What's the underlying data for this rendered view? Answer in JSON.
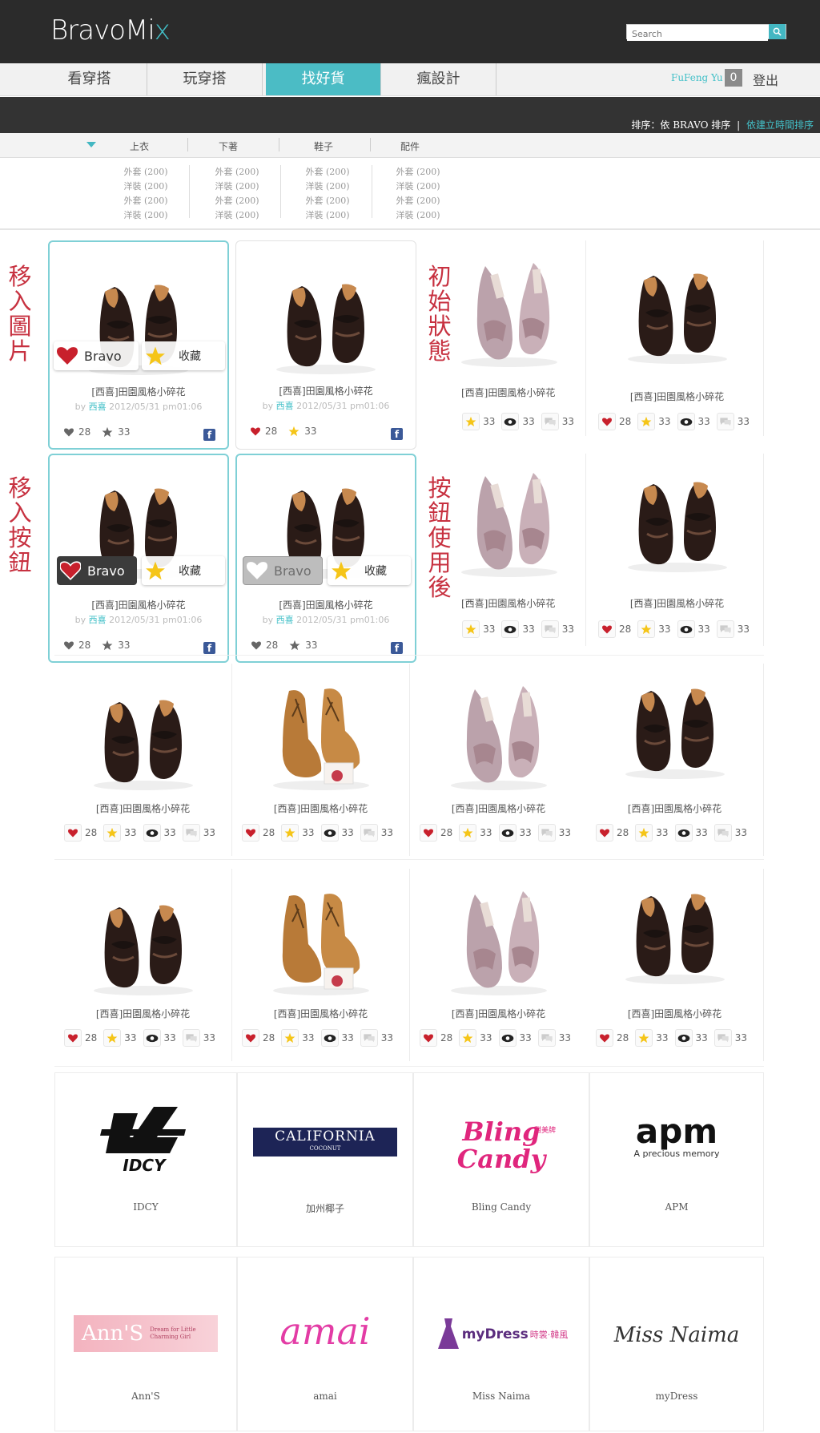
{
  "header": {
    "logo": "BravoMi",
    "logo_accent": "x",
    "search_placeholder": "Search",
    "user_name": "FuFeng Yu",
    "badge_count": "0",
    "logout": "登出"
  },
  "nav": {
    "tabs": [
      "看穿搭",
      "玩穿搭",
      "找好貨",
      "瘋設計"
    ],
    "active": "找好貨"
  },
  "sort": {
    "label": "排序：依 BRAVO 排序",
    "sep": "|",
    "link": "依建立時間排序"
  },
  "categories": {
    "heads": [
      "上衣",
      "下著",
      "鞋子",
      "配件"
    ],
    "sub": [
      "外套 (200)",
      "洋裝 (200)",
      "外套 (200)",
      "洋裝 (200)"
    ]
  },
  "annotations": {
    "a1": "移入圖片",
    "a2": "初始狀態",
    "a3": "移入按鈕",
    "a4": "按鈕使用後"
  },
  "product": {
    "title": "[西喜]田園風格小碎花",
    "by": "by",
    "user": "西喜",
    "date": "2012/05/31 pm01:06",
    "bravo_count": "28",
    "fav_count": "33",
    "view_count": "33",
    "comment_count": "33",
    "bravo_label": "Bravo",
    "fav_label": "收藏",
    "fb": "f"
  },
  "brands": [
    {
      "name": "IDCY",
      "logo": "IDCY"
    },
    {
      "name": "加州椰子",
      "logo": "CALIFORNIA"
    },
    {
      "name": "Bling Candy",
      "logo": "Bling Candy"
    },
    {
      "name": "APM",
      "logo": "apm"
    },
    {
      "name": "Ann'S",
      "logo": "Ann'S"
    },
    {
      "name": "amai",
      "logo": "amai"
    },
    {
      "name": "Miss Naima",
      "logo": "myDress"
    },
    {
      "name": "myDress",
      "logo": "Miss Naima"
    }
  ],
  "brand_logo_sub": {
    "california": "COCONUT",
    "apm": "A precious memory",
    "mydress": "時裳·韓風",
    "annsub": "Dream for Little Charming Girl",
    "blingsub": "甜美牌"
  },
  "colors": {
    "accent": "#43c0c8",
    "annotation": "#c73140",
    "heart": "#c8202c",
    "star": "#f5c518"
  }
}
